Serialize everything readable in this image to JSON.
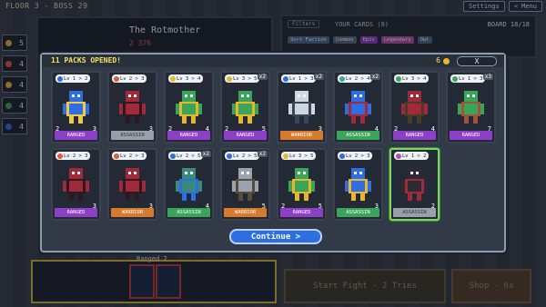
{
  "hud": {
    "floor_label": "FLOOR 3 - BOSS 29",
    "settings_label": "Settings",
    "menu_label": "< Menu"
  },
  "sidebar": {
    "items": [
      {
        "value": "5",
        "color": "#e8b62c"
      },
      {
        "value": "4",
        "color": "#e05a3c"
      },
      {
        "value": "4",
        "color": "#e8b62c"
      },
      {
        "value": "4",
        "color": "#3aa55a"
      },
      {
        "value": "4",
        "color": "#2f6ee0"
      }
    ]
  },
  "enemy": {
    "name": "The Rotmother",
    "hp": "2 376"
  },
  "cards_panel": {
    "filters_label": "Filters",
    "your_cards_label": "YOUR CARDS (8)",
    "board_label": "BOARD 18/18",
    "filters": [
      {
        "label": "Sort Faction",
        "color": "#4a6a8a"
      },
      {
        "label": "Common",
        "color": "#5c6a80"
      },
      {
        "label": "Epic",
        "color": "#8e3fc8"
      },
      {
        "label": "Legendary",
        "color": "#b54fa8"
      },
      {
        "label": "Owl",
        "color": "#4a6a8a"
      }
    ]
  },
  "bottom": {
    "ranged_label": "Ranged 2",
    "start_fight_label": "Start Fight - 2 Tries",
    "shop_label": "Shop - 6x"
  },
  "modal": {
    "title": "11 PACKS OPENED!",
    "gold": "6",
    "close_label": "X",
    "continue_label": "Continue >",
    "cards": [
      {
        "lvl": "Lv 1 > 2",
        "gem": "#2f6ee0",
        "count": "",
        "atk": "2",
        "hp": "3",
        "cls": "RANGED",
        "cls_style": "ranged",
        "body": "#2f6ee0",
        "accent": "#f0c84a"
      },
      {
        "lvl": "Lv 2 > 3",
        "gem": "#e05a3c",
        "count": "",
        "atk": "",
        "hp": "3",
        "cls": "ASSASSIN",
        "cls_style": "assassin-gray",
        "body": "#a02a3a",
        "accent": "#2b1b20"
      },
      {
        "lvl": "Lv 3 > 4",
        "gem": "#e8b62c",
        "count": "",
        "atk": "2",
        "hp": "4",
        "cls": "RANGED",
        "cls_style": "ranged",
        "body": "#3aa55a",
        "accent": "#e8b62c"
      },
      {
        "lvl": "Lv 3 > 5",
        "gem": "#e8b62c",
        "count": "x2",
        "atk": "2",
        "hp": "5",
        "cls": "RANGED",
        "cls_style": "ranged",
        "body": "#3aa55a",
        "accent": "#e8b62c"
      },
      {
        "lvl": "Lv 1 > 3",
        "gem": "#2f6ee0",
        "count": "x2",
        "atk": "",
        "hp": "3",
        "cls": "WARRIOR",
        "cls_style": "warrior",
        "body": "#cfd6de",
        "accent": "#3a4658"
      },
      {
        "lvl": "Lv 2 > 4",
        "gem": "#3aa5a5",
        "count": "x2",
        "atk": "",
        "hp": "4",
        "cls": "ASSASSIN",
        "cls_style": "assassin",
        "body": "#2f6ee0",
        "accent": "#a02a3a"
      },
      {
        "lvl": "Lv 3 > 4",
        "gem": "#3aa55a",
        "count": "",
        "atk": "2",
        "hp": "4",
        "cls": "RANGED",
        "cls_style": "ranged",
        "body": "#a02a3a",
        "accent": "#4a3a2a"
      },
      {
        "lvl": "Lv 1 > 3",
        "gem": "#3aa55a",
        "count": "x3",
        "atk": "",
        "hp": "7",
        "cls": "RANGED",
        "cls_style": "ranged",
        "body": "#3aa55a",
        "accent": "#a0523a"
      },
      {
        "lvl": "Lv 2 > 3",
        "gem": "#e05a3c",
        "count": "",
        "atk": "",
        "hp": "3",
        "cls": "RANGED",
        "cls_style": "ranged",
        "body": "#a02a3a",
        "accent": "#2b1b20"
      },
      {
        "lvl": "Lv 2 > 3",
        "gem": "#e05a3c",
        "count": "",
        "atk": "",
        "hp": "3",
        "cls": "WARRIOR",
        "cls_style": "warrior",
        "body": "#a02a3a",
        "accent": "#2b1b20"
      },
      {
        "lvl": "Lv 2 > 5",
        "gem": "#2f6ee0",
        "count": "x2",
        "atk": "",
        "hp": "4",
        "cls": "ASSASSIN",
        "cls_style": "assassin",
        "body": "#3a8a7a",
        "accent": "#2f6ee0"
      },
      {
        "lvl": "Lv 2 > 5",
        "gem": "#2f6ee0",
        "count": "x2",
        "atk": "",
        "hp": "5",
        "cls": "WARRIOR",
        "cls_style": "warrior",
        "body": "#9aa4b0",
        "accent": "#5a4a3a"
      },
      {
        "lvl": "Lv 3 > 5",
        "gem": "#e8b62c",
        "count": "",
        "atk": "2",
        "hp": "5",
        "cls": "RANGED",
        "cls_style": "ranged",
        "body": "#3aa55a",
        "accent": "#e8b62c"
      },
      {
        "lvl": "Lv 2 > 3",
        "gem": "#2f6ee0",
        "count": "",
        "atk": "",
        "hp": "3",
        "cls": "ASSASSIN",
        "cls_style": "assassin",
        "body": "#2f6ee0",
        "accent": "#e8b62c"
      },
      {
        "lvl": "Lv 1 > 2",
        "gem": "#b54fa8",
        "count": "",
        "atk": "",
        "hp": "2",
        "cls": "ASSASSIN",
        "cls_style": "assassin-gray",
        "body": "#2b2b35",
        "accent": "#a02a3a",
        "selected": true
      }
    ]
  }
}
